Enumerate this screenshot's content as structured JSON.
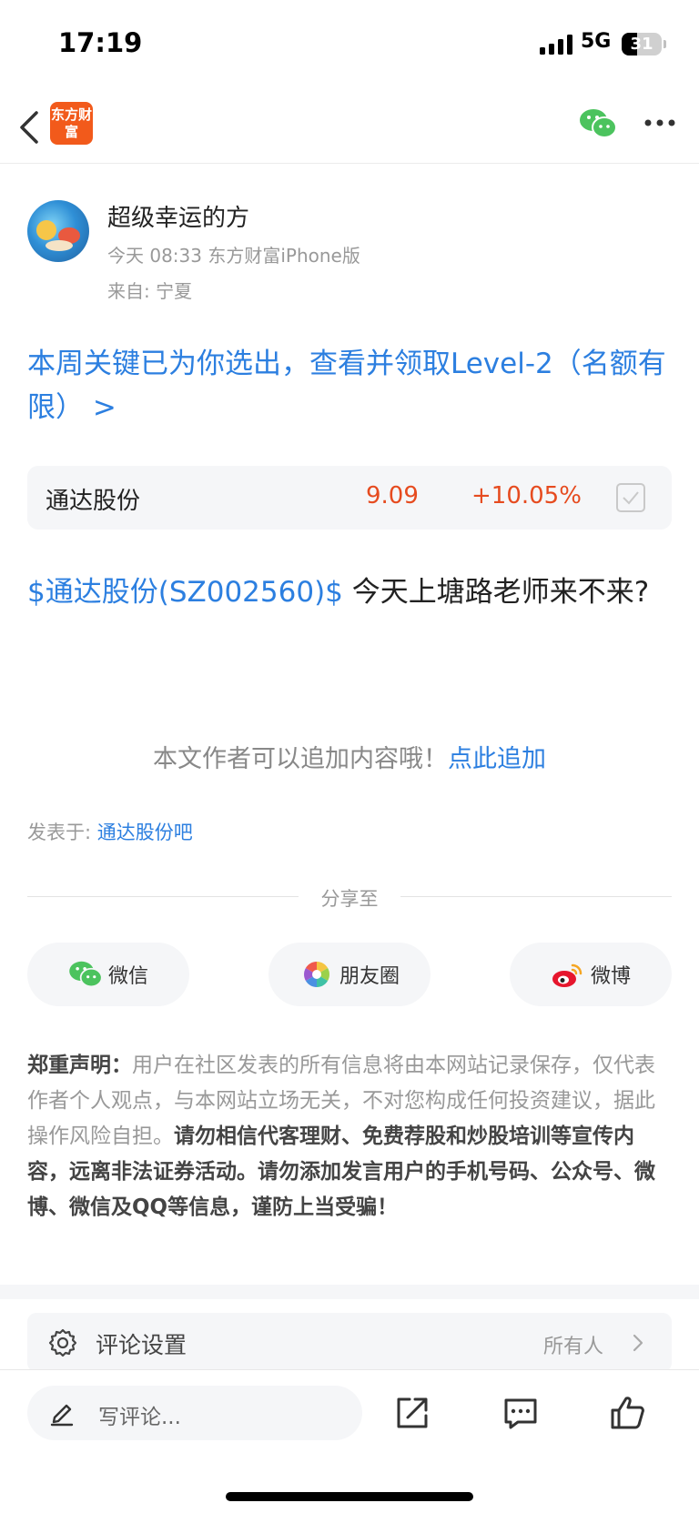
{
  "status_bar": {
    "time": "17:19",
    "network": "5G",
    "battery": "31"
  },
  "nav": {
    "logo_text": "东方财富",
    "back_icon": "chevron-left-icon",
    "share_icon": "wechat-icon",
    "more_icon": "more-dots-icon"
  },
  "author": {
    "name": "超级幸运的方",
    "meta": "今天 08:33 东方财富iPhone版",
    "location": "来自: 宁夏"
  },
  "promo_text": "本周关键已为你选出，查看并领取Level-2（名额有限） >",
  "stock_card": {
    "name": "通达股份",
    "price": "9.09",
    "change": "+10.05%",
    "change_color": "#e64b1f"
  },
  "post": {
    "tag": "$通达股份(SZ002560)$",
    "text": " 今天上塘路老师来不来?"
  },
  "append_hint": {
    "text": "本文作者可以追加内容哦！",
    "link": "点此追加"
  },
  "posted_in": {
    "label": "发表于: ",
    "bar": "通达股份吧"
  },
  "share": {
    "title": "分享至",
    "buttons": [
      {
        "label": "微信",
        "icon": "wechat-icon"
      },
      {
        "label": "朋友圈",
        "icon": "moments-icon"
      },
      {
        "label": "微博",
        "icon": "weibo-icon"
      }
    ]
  },
  "disclaimer": {
    "title": "郑重声明：",
    "normal": "用户在社区发表的所有信息将由本网站记录保存，仅代表作者个人观点，与本网站立场无关，不对您构成任何投资建议，据此操作风险自担。",
    "bold": "请勿相信代客理财、免费荐股和炒股培训等宣传内容，远离非法证券活动。请勿添加发言用户的手机号码、公众号、微博、微信及QQ等信息，谨防上当受骗！"
  },
  "comment_settings": {
    "label": "评论设置",
    "value": "所有人"
  },
  "bottom_bar": {
    "placeholder": "写评论...",
    "icons": [
      "share-out-icon",
      "comment-icon",
      "like-icon"
    ]
  },
  "colors": {
    "link_blue": "#2c7fe0",
    "up_red": "#e64b1f",
    "brand_orange": "#f25a1b"
  }
}
